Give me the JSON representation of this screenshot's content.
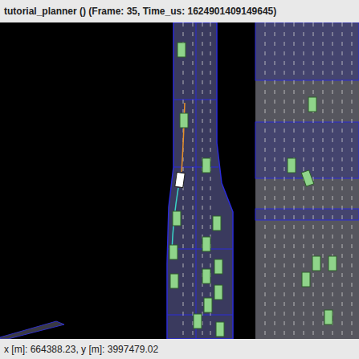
{
  "window": {
    "title": "tutorial_planner () (Frame: 35, Time_us: 1624901409149645)"
  },
  "status_bar": {
    "text": "x [m]: 664388.23, y [m]: 3997479.02"
  },
  "vehicles": [
    {
      "kind": "ego"
    },
    {
      "kind": "agent"
    },
    {
      "kind": "agent"
    },
    {
      "kind": "agent"
    },
    {
      "kind": "agent"
    },
    {
      "kind": "agent"
    },
    {
      "kind": "agent"
    },
    {
      "kind": "agent"
    },
    {
      "kind": "agent"
    },
    {
      "kind": "agent"
    },
    {
      "kind": "agent"
    },
    {
      "kind": "agent"
    },
    {
      "kind": "agent"
    },
    {
      "kind": "agent"
    },
    {
      "kind": "agent"
    },
    {
      "kind": "agent"
    },
    {
      "kind": "agent"
    },
    {
      "kind": "agent"
    },
    {
      "kind": "agent"
    },
    {
      "kind": "agent"
    },
    {
      "kind": "agent"
    },
    {
      "kind": "agent"
    }
  ],
  "trajectories": [
    {
      "name": "planned",
      "color": "#e8902a"
    },
    {
      "name": "history",
      "color": "#3ad6c8"
    }
  ]
}
